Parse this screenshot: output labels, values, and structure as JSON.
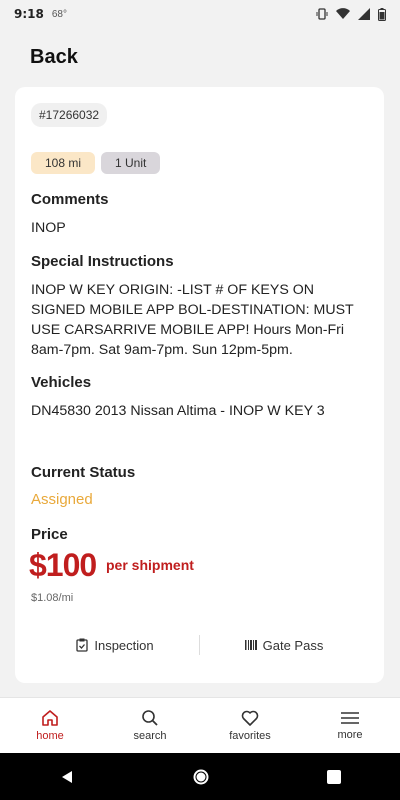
{
  "status_bar": {
    "time": "9:18",
    "temp": "68°"
  },
  "header": {
    "back_label": "Back"
  },
  "order": {
    "id": "#17266032",
    "distance": "108 mi",
    "units": "1 Unit",
    "comments_title": "Comments",
    "comments": "INOP",
    "special_title": "Special Instructions",
    "special_text": "INOP W KEY    ORIGIN: -LIST # OF KEYS ON SIGNED MOBILE APP BOL-DESTINATION: MUST USE CARSARRIVE MOBILE APP! Hours Mon-Fri 8am-7pm. Sat 9am-7pm. Sun 12pm-5pm.",
    "vehicles_title": "Vehicles",
    "vehicles_text": "DN45830 2013 Nissan Altima - INOP W KEY 3",
    "status_title": "Current Status",
    "status_value": "Assigned",
    "price_title": "Price",
    "price": "$100",
    "price_unit": "per shipment",
    "price_per_mile": "$1.08/mi",
    "inspection_label": "Inspection",
    "gate_pass_label": "Gate Pass"
  },
  "nav": {
    "home": "home",
    "search": "search",
    "favorites": "favorites",
    "more": "more"
  },
  "colors": {
    "accent": "#c01e1e",
    "status_assigned": "#e9a93b"
  }
}
